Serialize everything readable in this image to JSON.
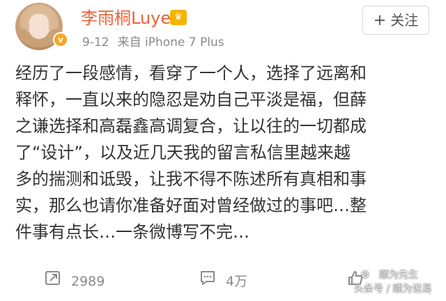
{
  "post": {
    "username": "李雨桐Luyee",
    "date": "9-12",
    "source": "来自 iPhone 7 Plus",
    "follow_label": "关注",
    "content_lines": [
      "经历了一段感情，看穿了一个人，选择了远离和",
      "释怀，一直以来的隐忍是劝自己平淡是福，但薛",
      "之谦选择和高磊鑫高调复合，让以往的一切都成",
      "了“设计”，以及近几天我的留言私信里越来越",
      "多的揣测和诋毁，让我不得不陈述所有真相和事",
      "实，那么也请你准备好面对曾经做过的事吧…整",
      "件事有点长…一条微博写不完…"
    ]
  },
  "footer": {
    "repost_count": "2989",
    "comment_count": "4万"
  },
  "watermark": {
    "brand": "顺为先生",
    "sub": "头条号 / 顺为说易"
  },
  "colors": {
    "username": "#e8633a",
    "meta": "#8a8a8a",
    "text": "#333333",
    "badge": "#f5a623"
  },
  "icons": {
    "verified": "v-badge-icon",
    "member": "crown-icon",
    "repost": "repost-icon",
    "comment": "comment-icon",
    "like": "thumbs-up-icon"
  }
}
